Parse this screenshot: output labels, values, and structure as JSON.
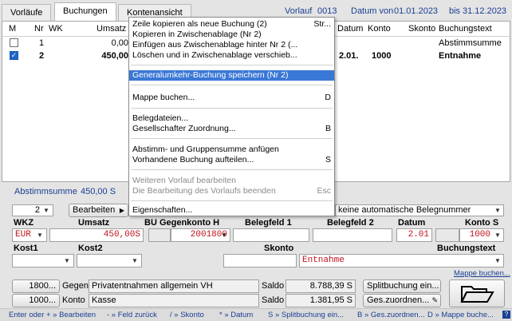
{
  "tabs": [
    "Vorläufe",
    "Buchungen",
    "Kontenansicht"
  ],
  "header": {
    "vorlauf_label": "Vorlauf",
    "vorlauf_nr": "0013",
    "datum_von_label": "Datum von",
    "datum_von": "01.01.2023",
    "bis_label": "bis",
    "datum_bis": "31.12.2023"
  },
  "grid": {
    "columns": [
      "M",
      "Nr",
      "WK",
      "Umsatz",
      "Datum",
      "Konto",
      "Skonto",
      "Buchungstext"
    ],
    "rows": [
      {
        "nr": "1",
        "umsatz": "0,00",
        "text": "Abstimmsumme",
        "datum": "",
        "konto": ""
      },
      {
        "nr": "2",
        "umsatz": "450,00",
        "text": "Entnahme",
        "datum": "2.01.",
        "konto": "1000"
      }
    ]
  },
  "menu": {
    "items": [
      {
        "label": "Zeile kopieren als neue Buchung (2)",
        "shortcut": "Str..."
      },
      {
        "label": "Kopieren in Zwischenablage (Nr 2)",
        "shortcut": ""
      },
      {
        "label": "Einfügen aus Zwischenablage hinter Nr 2 (...",
        "shortcut": ""
      },
      {
        "label": "Löschen und in Zwischenablage verschieb...",
        "shortcut": ""
      },
      {
        "label": "Generalumkehr-Buchung speichern (Nr 2)",
        "shortcut": ""
      },
      {
        "label": "Mappe buchen...",
        "shortcut": "D"
      },
      {
        "label": "Belegdateien...",
        "shortcut": ""
      },
      {
        "label": "Gesellschafter Zuordnung...",
        "shortcut": "B"
      },
      {
        "label": "Abstimm- und Gruppensumme anfügen",
        "shortcut": ""
      },
      {
        "label": "Vorhandene Buchung aufteilen...",
        "shortcut": "S"
      },
      {
        "label": "Weiteren Vorlauf bearbeiten",
        "shortcut": ""
      },
      {
        "label": "Die Bearbeitung des Vorlaufs beenden",
        "shortcut": "Esc"
      },
      {
        "label": "Eigenschaften...",
        "shortcut": ""
      }
    ]
  },
  "form": {
    "abstimmsumme_label": "Abstimmsumme",
    "abstimmsumme_value": "450,00 S",
    "count_value": "2",
    "bearbeiten_label": "Bearbeiten",
    "belegnummer_value": "keine automatische Belegnummer",
    "labels": {
      "wkz": "WKZ",
      "umsatz": "Umsatz",
      "bu_gegenkonto": "BU Gegenkonto H",
      "belegfeld1": "Belegfeld 1",
      "belegfeld2": "Belegfeld 2",
      "datum": "Datum",
      "konto": "Konto S",
      "kost1": "Kost1",
      "kost2": "Kost2",
      "skonto": "Skonto",
      "buchungstext": "Buchungstext"
    },
    "values": {
      "wkz": "EUR",
      "umsatz": "450,00S",
      "gegenkonto": "2001800",
      "belegfeld1": "",
      "belegfeld2": "",
      "datum": "2.01",
      "konto": "1000",
      "buchungstext": "Entnahme"
    },
    "mappe_buchen_link": "Mappe buchen...",
    "gegen_nr": "1800...",
    "gegen_label": "Gegen",
    "gegen_name": "Privatentnahmen allgemein VH",
    "saldo_label": "Saldo",
    "gegen_saldo": "8.788,39 S",
    "konto_nr": "1000...",
    "konto_label": "Konto",
    "konto_name": "Kasse",
    "konto_saldo": "1.381,95 S",
    "splitbuchung_button": "Splitbuchung ein...",
    "zuordnen_button": "Ges.zuordnen..."
  },
  "statusbar": [
    "Enter oder + » Bearbeiten",
    "- » Feld zurück",
    "/ » Skonto",
    "* » Datum",
    "S » Splitbuchung ein...",
    "B » Ges.zuordnen...",
    "D » Mappe buche..."
  ]
}
